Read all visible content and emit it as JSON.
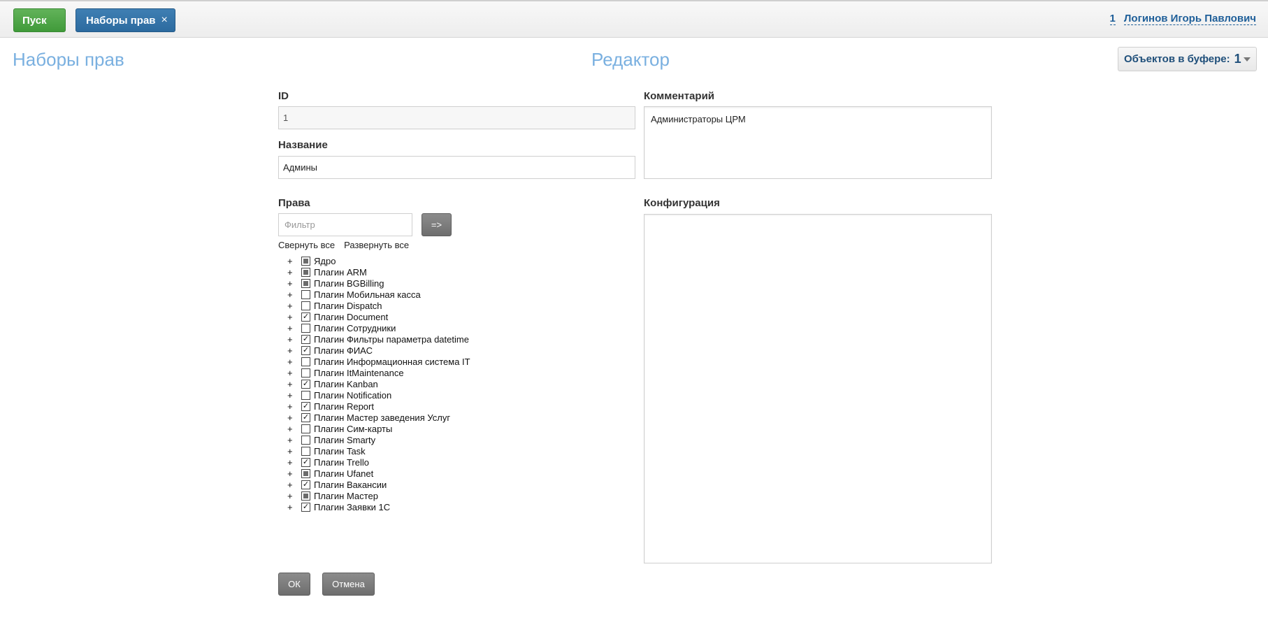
{
  "topbar": {
    "start_label": "Пуск",
    "tab_label": "Наборы прав",
    "tab_close": "×",
    "user_count": "1",
    "user_name": "Логинов Игорь Павлович"
  },
  "header": {
    "page_title": "Наборы прав",
    "editor_title": "Редактор",
    "buffer_label": "Объектов в буфере:",
    "buffer_count": "1"
  },
  "form": {
    "id_label": "ID",
    "id_value": "1",
    "name_label": "Название",
    "name_value": "Админы",
    "comment_label": "Комментарий",
    "comment_value": "Администраторы ЦРМ",
    "rights_label": "Права",
    "filter_placeholder": "Фильтр",
    "filter_button": "=>",
    "collapse_all": "Свернуть все",
    "expand_all": "Развернуть все",
    "config_label": "Конфигурация",
    "config_value": "",
    "ok_button": "ОК",
    "cancel_button": "Отмена"
  },
  "rights_tree": [
    {
      "label": "Ядро",
      "state": "partial"
    },
    {
      "label": "Плагин ARM",
      "state": "partial"
    },
    {
      "label": "Плагин BGBilling",
      "state": "partial"
    },
    {
      "label": "Плагин Мобильная касса",
      "state": "unchecked"
    },
    {
      "label": "Плагин Dispatch",
      "state": "unchecked"
    },
    {
      "label": "Плагин Document",
      "state": "checked"
    },
    {
      "label": "Плагин Сотрудники",
      "state": "unchecked"
    },
    {
      "label": "Плагин Фильтры параметра datetime",
      "state": "checked"
    },
    {
      "label": "Плагин ФИАС",
      "state": "checked"
    },
    {
      "label": "Плагин Информационная система IT",
      "state": "unchecked"
    },
    {
      "label": "Плагин ItMaintenance",
      "state": "unchecked"
    },
    {
      "label": "Плагин Kanban",
      "state": "checked"
    },
    {
      "label": "Плагин Notification",
      "state": "unchecked"
    },
    {
      "label": "Плагин Report",
      "state": "checked"
    },
    {
      "label": "Плагин Мастер заведения Услуг",
      "state": "checked"
    },
    {
      "label": "Плагин Сим-карты",
      "state": "unchecked"
    },
    {
      "label": "Плагин Smarty",
      "state": "unchecked"
    },
    {
      "label": "Плагин Task",
      "state": "unchecked"
    },
    {
      "label": "Плагин Trello",
      "state": "checked"
    },
    {
      "label": "Плагин Ufanet",
      "state": "partial"
    },
    {
      "label": "Плагин Вакансии",
      "state": "checked"
    },
    {
      "label": "Плагин Мастер",
      "state": "partial"
    },
    {
      "label": "Плагин Заявки 1С",
      "state": "checked"
    }
  ],
  "tree_expander": "+"
}
